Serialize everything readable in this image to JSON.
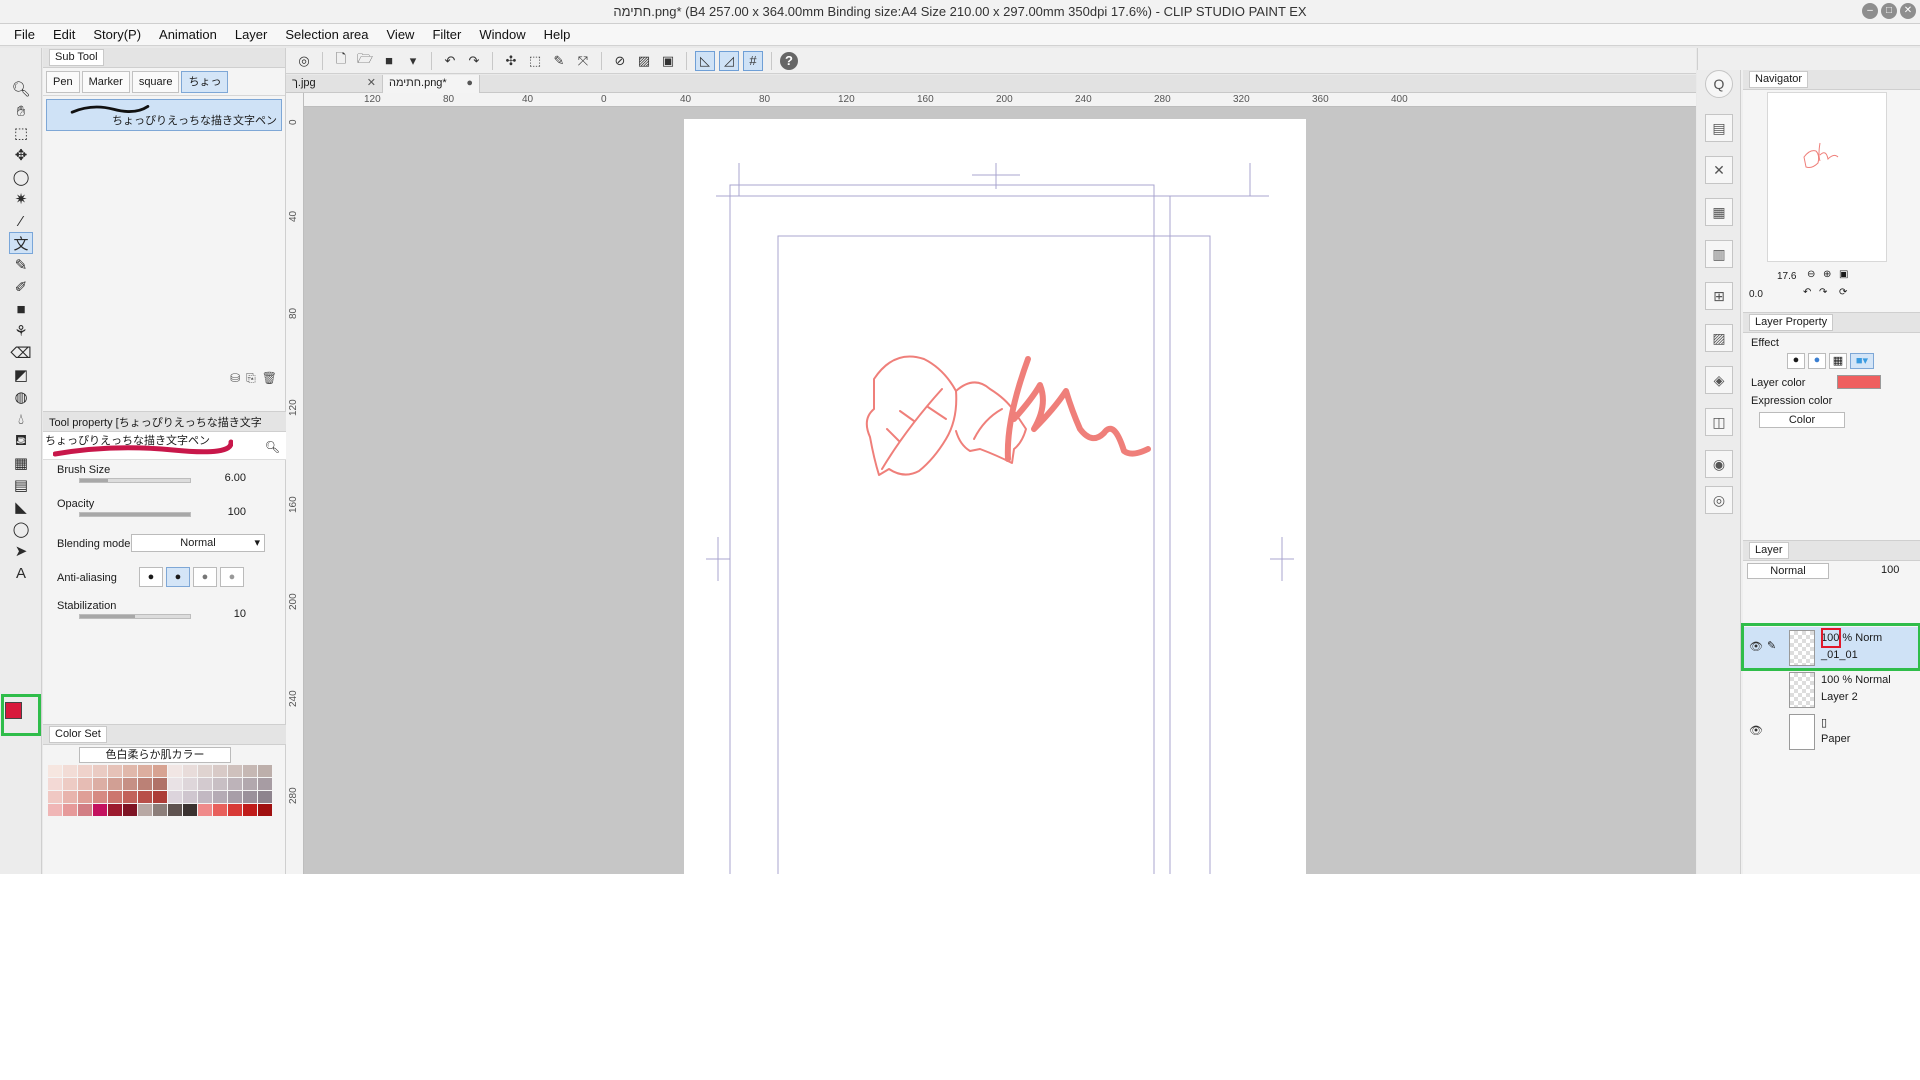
{
  "window": {
    "title": "חתימה.png* (B4 257.00 x 364.00mm Binding size:A4 Size 210.00 x 297.00mm 350dpi 17.6%) - CLIP STUDIO PAINT EX"
  },
  "menu": [
    "File",
    "Edit",
    "Story(P)",
    "Animation",
    "Layer",
    "Selection area",
    "View",
    "Filter",
    "Window",
    "Help"
  ],
  "subtool": {
    "header": "Sub Tool",
    "tabs": [
      "Pen",
      "Marker",
      "square",
      "ちょっ"
    ],
    "brush_name": "ちょっぴりえっちな描き文字ペン"
  },
  "tool_property": {
    "header": "Tool property [ちょっぴりえっちな描き文字",
    "brush_name": "ちょっぴりえっちな描き文字ペン",
    "brush_size_label": "Brush Size",
    "brush_size": "6.00",
    "brush_size_level": 0.25,
    "opacity_label": "Opacity",
    "opacity": "100",
    "opacity_level": 1.0,
    "blending_label": "Blending mode",
    "blending_value": "Normal",
    "antialias_label": "Anti-aliasing",
    "stabilization_label": "Stabilization",
    "stabilization": "10",
    "stabilization_level": 0.5
  },
  "colorset": {
    "tab": "Color Set",
    "set_name": "色白柔らか肌カラー",
    "swatches": [
      "#f6e6e0",
      "#f2dcd6",
      "#efd2cb",
      "#eacbc3",
      "#e6c2b8",
      "#e0b8ab",
      "#dcae9f",
      "#d7a392",
      "#f1e6e4",
      "#e8dcda",
      "#dfd3d0",
      "#d8cac7",
      "#cfc1bd",
      "#c6b8b4",
      "#bdafab",
      "#f3d9d5",
      "#edcbc4",
      "#e6bcb4",
      "#dcaea4",
      "#d19f94",
      "#c69085",
      "#bb8176",
      "#b07268",
      "#e9e2e5",
      "#ded6da",
      "#d3cacf",
      "#c8bfc4",
      "#bdb3b9",
      "#b2a8ae",
      "#a79ca3",
      "#f0c8c3",
      "#e8b4ad",
      "#df9f97",
      "#d68a82",
      "#cc766e",
      "#c2625b",
      "#b84f49",
      "#ad3d38",
      "#dcd4dc",
      "#cfc6cf",
      "#c2b8c2",
      "#b5abb5",
      "#a89ea8",
      "#9b919b",
      "#8e848e",
      "#f0b6b6",
      "#e69a9a",
      "#d27e84",
      "#c3125f",
      "#9c1a2e",
      "#7e1424",
      "#b8a8a4",
      "#8c7e7a",
      "#5e524f",
      "#3a3230",
      "#f08a8a",
      "#e8605c",
      "#d83a36",
      "#c01c1a",
      "#a01010"
    ]
  },
  "documents": {
    "tabs": [
      {
        "label": "ך.jpg"
      },
      {
        "label": "חתימה.png*"
      }
    ]
  },
  "rulers": {
    "top": [
      "120",
      "80",
      "40",
      "0",
      "40",
      "80",
      "120",
      "160",
      "200",
      "240",
      "280",
      "320",
      "360",
      "400"
    ],
    "left": [
      "0",
      "40",
      "80",
      "120",
      "160",
      "200",
      "240",
      "280"
    ]
  },
  "navigator": {
    "tab": "Navigator",
    "zoom": "17.6",
    "rotation": "0.0"
  },
  "layer_property": {
    "tab": "Layer Property",
    "effect_label": "Effect",
    "layer_color_label": "Layer color",
    "layer_color": "#ef5f5f",
    "expression_label": "Expression color",
    "expression_value": "Color"
  },
  "layers": {
    "tab": "Layer",
    "blend": "Normal",
    "opacity": "100",
    "items": [
      {
        "info": "100 % Norm",
        "name": "_01_01"
      },
      {
        "info": "100 % Normal",
        "name": "Layer 2"
      },
      {
        "info": "",
        "name": "Paper"
      }
    ]
  },
  "colors": {
    "main_color": "#d8193c",
    "sketch_color": "#ef7f7a",
    "highlight_green": "#2fbd4a",
    "highlight_red": "#e1182a"
  }
}
